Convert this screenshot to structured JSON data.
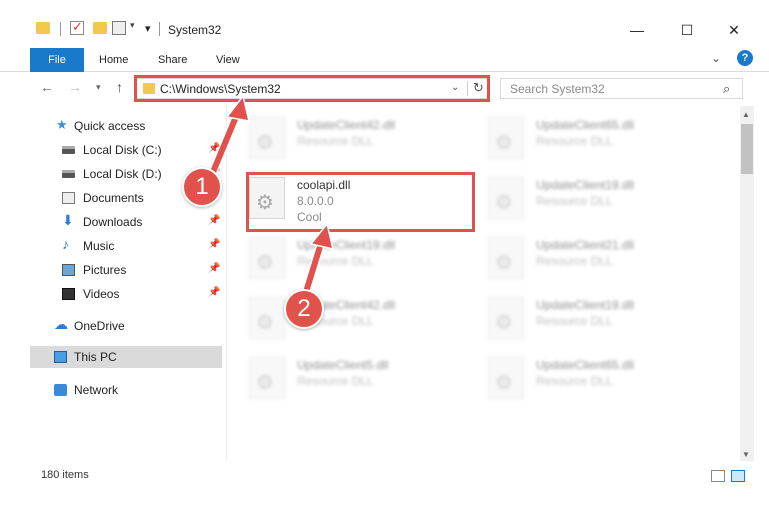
{
  "window": {
    "title": "System32",
    "minimize_glyph": "—",
    "maximize_glyph": "☐",
    "close_glyph": "✕"
  },
  "quick_access_toolbar": {
    "dropdown_glyph": "▾",
    "more_glyph": "▾"
  },
  "ribbon": {
    "tabs": [
      "File",
      "Home",
      "Share",
      "View"
    ],
    "collapse_glyph": "⌄",
    "help_glyph": "?"
  },
  "navigation": {
    "back_glyph": "←",
    "forward_glyph": "→",
    "recent_glyph": "▾",
    "up_glyph": "↑",
    "address": "C:\\Windows\\System32",
    "address_dropdown_glyph": "⌄",
    "refresh_glyph": "↻",
    "search_placeholder": "Search System32",
    "search_glyph": "⌕"
  },
  "sidebar": {
    "items": [
      {
        "label": "Quick access",
        "icon": "star-icon",
        "pinned": false
      },
      {
        "label": "Local Disk (C:)",
        "icon": "disk-icon",
        "pinned": true
      },
      {
        "label": "Local Disk (D:)",
        "icon": "disk-icon",
        "pinned": true
      },
      {
        "label": "Documents",
        "icon": "documents-icon",
        "pinned": true
      },
      {
        "label": "Downloads",
        "icon": "download-icon",
        "pinned": true
      },
      {
        "label": "Music",
        "icon": "music-icon",
        "pinned": true
      },
      {
        "label": "Pictures",
        "icon": "pictures-icon",
        "pinned": true
      },
      {
        "label": "Videos",
        "icon": "videos-icon",
        "pinned": true
      },
      {
        "label": "OneDrive",
        "icon": "cloud-icon",
        "pinned": false
      },
      {
        "label": "This PC",
        "icon": "pc-icon",
        "pinned": false
      },
      {
        "label": "Network",
        "icon": "network-icon",
        "pinned": false
      }
    ],
    "pin_glyph": "📌"
  },
  "files": {
    "left_column": [
      {
        "name": "UpdateClient42.dll",
        "type": "Resource DLL"
      },
      {
        "name": "coolapi.dll",
        "version": "8.0.0.0",
        "company": "Cool"
      },
      {
        "name": "UpdateClient19.dll",
        "type": "Resource DLL"
      },
      {
        "name": "UpdateClient42.dll",
        "type": "Resource DLL"
      },
      {
        "name": "UpdateClient5.dll",
        "type": "Resource DLL"
      }
    ],
    "right_column": [
      {
        "name": "UpdateClient65.dll",
        "type": "Resource DLL"
      },
      {
        "name": "UpdateClient19.dll",
        "type": "Resource DLL"
      },
      {
        "name": "UpdateClient21.dll",
        "type": "Resource DLL"
      },
      {
        "name": "UpdateClient19.dll",
        "type": "Resource DLL"
      },
      {
        "name": "UpdateClient65.dll",
        "type": "Resource DLL"
      }
    ],
    "file_icon_glyph": "⚙"
  },
  "callouts": [
    "1",
    "2"
  ],
  "highlight_color": "#e0524b",
  "accent_color": "#1979ca",
  "status": {
    "item_count": "180 items"
  },
  "scrollbar": {
    "up_glyph": "▲",
    "down_glyph": "▼"
  }
}
